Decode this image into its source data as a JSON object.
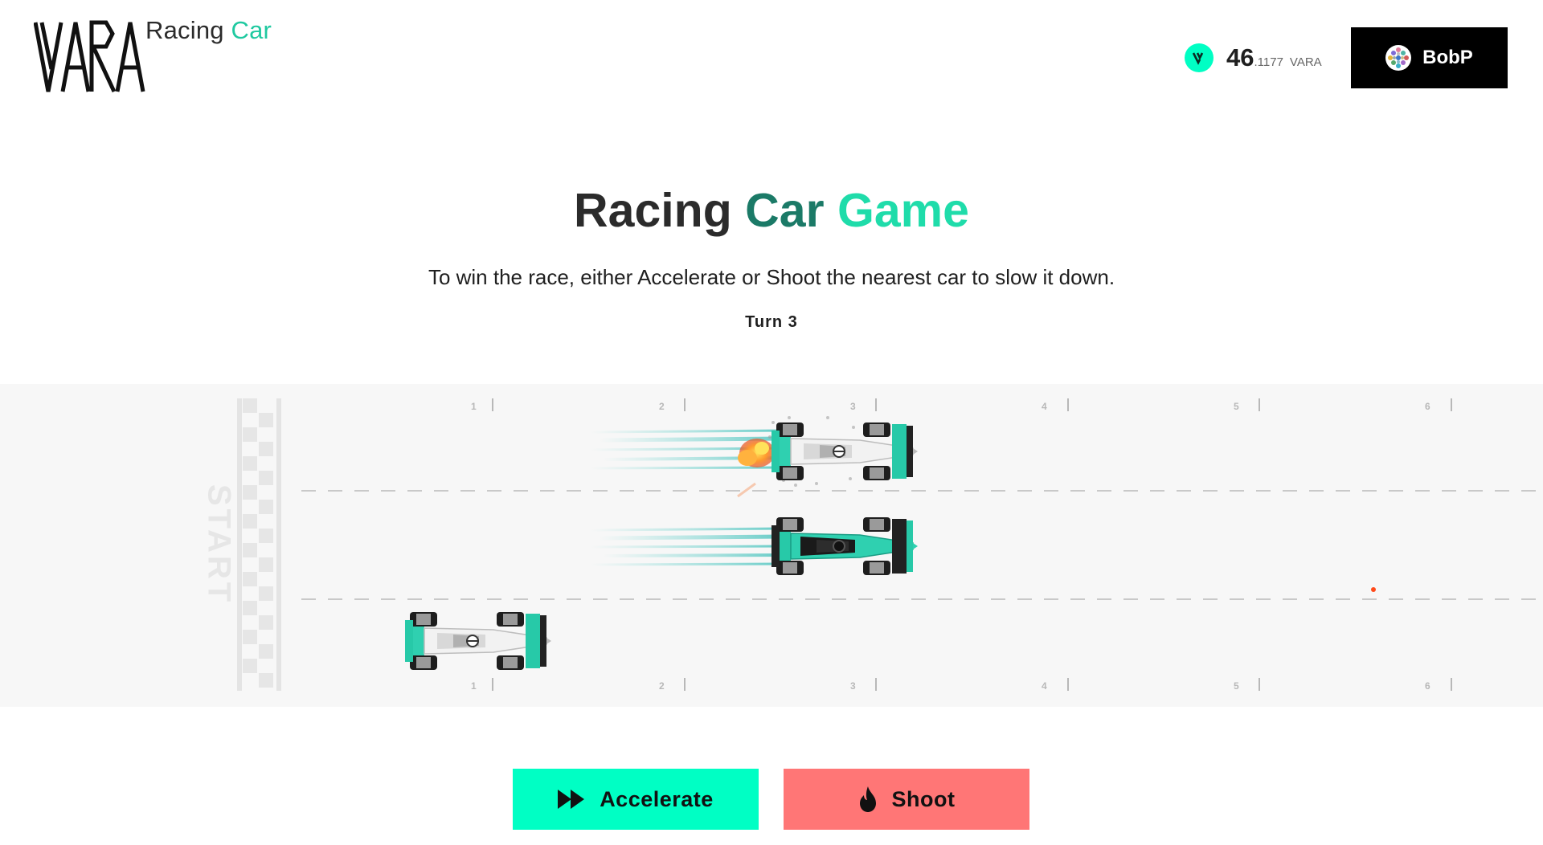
{
  "header": {
    "logo_text": "VARA",
    "app_name_part1": "Racing",
    "app_name_part2": "Car",
    "balance": {
      "integer": "46",
      "decimal": ".1177",
      "unit": "VARA"
    },
    "account": {
      "name": "BobP"
    }
  },
  "main": {
    "title_part1": "Racing",
    "title_part2": "Car",
    "title_part3": "Game",
    "subtitle": "To win the race, either Accelerate or Shoot the nearest car to slow it down.",
    "turn_label": "Turn 3"
  },
  "track": {
    "start_label": "START",
    "top_markers": [
      "1",
      "2",
      "3",
      "4",
      "5",
      "6"
    ],
    "bottom_markers": [
      "1",
      "2",
      "3",
      "4",
      "5",
      "6"
    ],
    "cars": [
      {
        "lane": 1,
        "icon": "race-car-white",
        "effect": "explosion"
      },
      {
        "lane": 2,
        "icon": "race-car-teal",
        "effect": "speed-lines"
      },
      {
        "lane": 3,
        "icon": "race-car-white",
        "effect": "none"
      }
    ]
  },
  "actions": {
    "accelerate_label": "Accelerate",
    "shoot_label": "Shoot"
  },
  "colors": {
    "accent": "#00ffc4",
    "accent_dark": "#1b7a67",
    "shoot": "#ff7676",
    "track_bg": "#f7f7f7"
  }
}
